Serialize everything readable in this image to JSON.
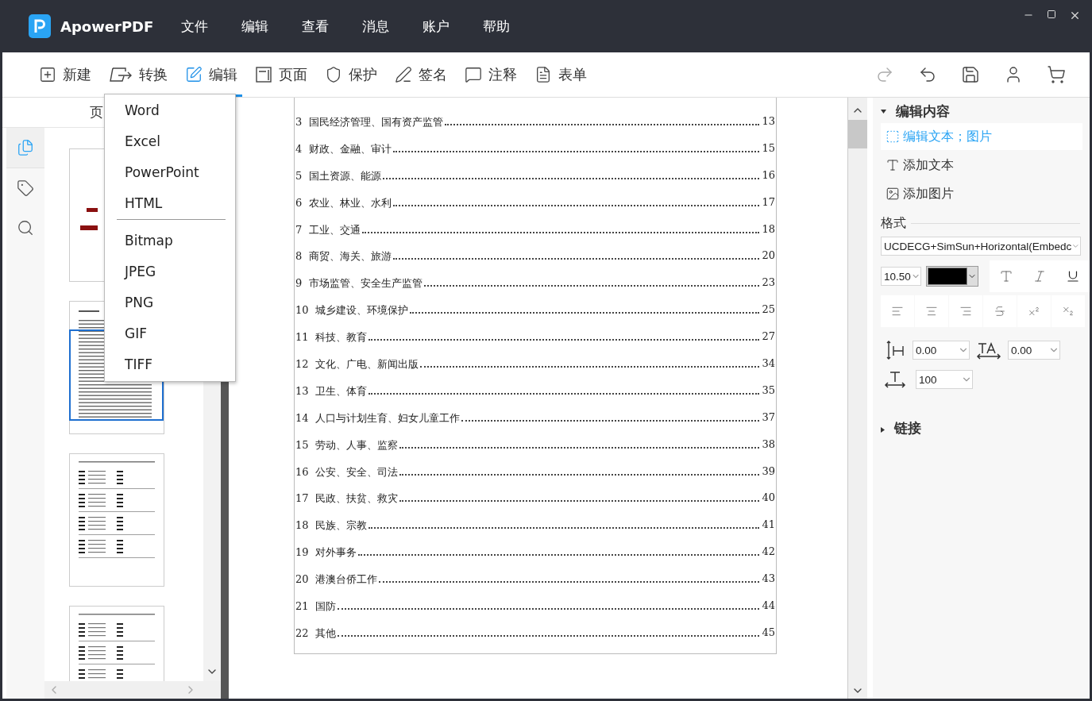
{
  "app": {
    "name": "ApowerPDF"
  },
  "menu": [
    {
      "label": "文件"
    },
    {
      "label": "编辑"
    },
    {
      "label": "查看"
    },
    {
      "label": "消息"
    },
    {
      "label": "账户"
    },
    {
      "label": "帮助"
    }
  ],
  "toolbar": [
    {
      "kind": "new",
      "label": "新建",
      "selected": false
    },
    {
      "kind": "convert",
      "label": "转换",
      "selected": false
    },
    {
      "kind": "edit",
      "label": "编辑",
      "selected": true
    },
    {
      "kind": "page",
      "label": "页面",
      "selected": false
    },
    {
      "kind": "protect",
      "label": "保护",
      "selected": false
    },
    {
      "kind": "sign",
      "label": "签名",
      "selected": false
    },
    {
      "kind": "comment",
      "label": "注释",
      "selected": false
    },
    {
      "kind": "form",
      "label": "表单",
      "selected": false
    }
  ],
  "actions": [
    {
      "kind": "redo",
      "disabled": true
    },
    {
      "kind": "undo",
      "disabled": false
    },
    {
      "kind": "save",
      "disabled": false
    },
    {
      "kind": "account",
      "disabled": false
    },
    {
      "kind": "cart",
      "disabled": false
    }
  ],
  "left_panel": {
    "title": "页",
    "tabs": [
      {
        "kind": "pages",
        "selected": true
      },
      {
        "kind": "tags",
        "selected": false
      },
      {
        "kind": "search",
        "selected": false
      }
    ],
    "thumbnails": [
      {
        "kind": "cover",
        "selected": false
      },
      {
        "kind": "toc",
        "selected": true
      },
      {
        "kind": "list",
        "selected": false
      },
      {
        "kind": "list",
        "selected": false
      }
    ]
  },
  "convert_menu": [
    {
      "kind": "option",
      "label": "Word"
    },
    {
      "kind": "option",
      "label": "Excel"
    },
    {
      "kind": "option",
      "label": "PowerPoint"
    },
    {
      "kind": "option",
      "label": "HTML"
    },
    {
      "kind": "separator"
    },
    {
      "kind": "option",
      "label": "Bitmap"
    },
    {
      "kind": "option",
      "label": "JPEG"
    },
    {
      "kind": "option",
      "label": "PNG"
    },
    {
      "kind": "option",
      "label": "GIF"
    },
    {
      "kind": "option",
      "label": "TIFF"
    }
  ],
  "document": {
    "toc": [
      {
        "number": "3",
        "title": "国民经济管理、国有资产监管",
        "page": "13"
      },
      {
        "number": "4",
        "title": "财政、金融、审计",
        "page": "15"
      },
      {
        "number": "5",
        "title": "国土资源、能源",
        "page": "16"
      },
      {
        "number": "6",
        "title": "农业、林业、水利",
        "page": "17"
      },
      {
        "number": "7",
        "title": "工业、交通",
        "page": "18"
      },
      {
        "number": "8",
        "title": "商贸、海关、旅游",
        "page": "20"
      },
      {
        "number": "9",
        "title": "市场监管、安全生产监管",
        "page": "23"
      },
      {
        "number": "10",
        "title": "城乡建设、环境保护",
        "page": "25"
      },
      {
        "number": "11",
        "title": "科技、教育",
        "page": "27"
      },
      {
        "number": "12",
        "title": "文化、广电、新闻出版",
        "page": "34"
      },
      {
        "number": "13",
        "title": "卫生、体育",
        "page": "35"
      },
      {
        "number": "14",
        "title": "人口与计划生育、妇女儿童工作",
        "page": "37"
      },
      {
        "number": "15",
        "title": "劳动、人事、监察",
        "page": "38"
      },
      {
        "number": "16",
        "title": "公安、安全、司法",
        "page": "39"
      },
      {
        "number": "17",
        "title": "民政、扶贫、救灾",
        "page": "40"
      },
      {
        "number": "18",
        "title": "民族、宗教",
        "page": "41"
      },
      {
        "number": "19",
        "title": "对外事务",
        "page": "42"
      },
      {
        "number": "20",
        "title": "港澳台侨工作",
        "page": "43"
      },
      {
        "number": "21",
        "title": "国防",
        "page": "44"
      },
      {
        "number": "22",
        "title": "其他",
        "page": "45"
      }
    ]
  },
  "right_panel": {
    "edit_section": {
      "title": "编辑内容",
      "expanded": true,
      "items": [
        {
          "kind": "edit",
          "label": "编辑文本；图片",
          "selected": true
        },
        {
          "kind": "text",
          "label": "添加文本",
          "selected": false
        },
        {
          "kind": "image",
          "label": "添加图片",
          "selected": false
        }
      ]
    },
    "format": {
      "title": "格式",
      "font": "UCDECG+SimSun+Horizontal(Embedc",
      "size": "10.50",
      "color": "#000000",
      "line_spacing": "0.00",
      "char_spacing": "0.00",
      "scale": "100"
    },
    "link_section": {
      "title": "链接",
      "expanded": false
    }
  }
}
